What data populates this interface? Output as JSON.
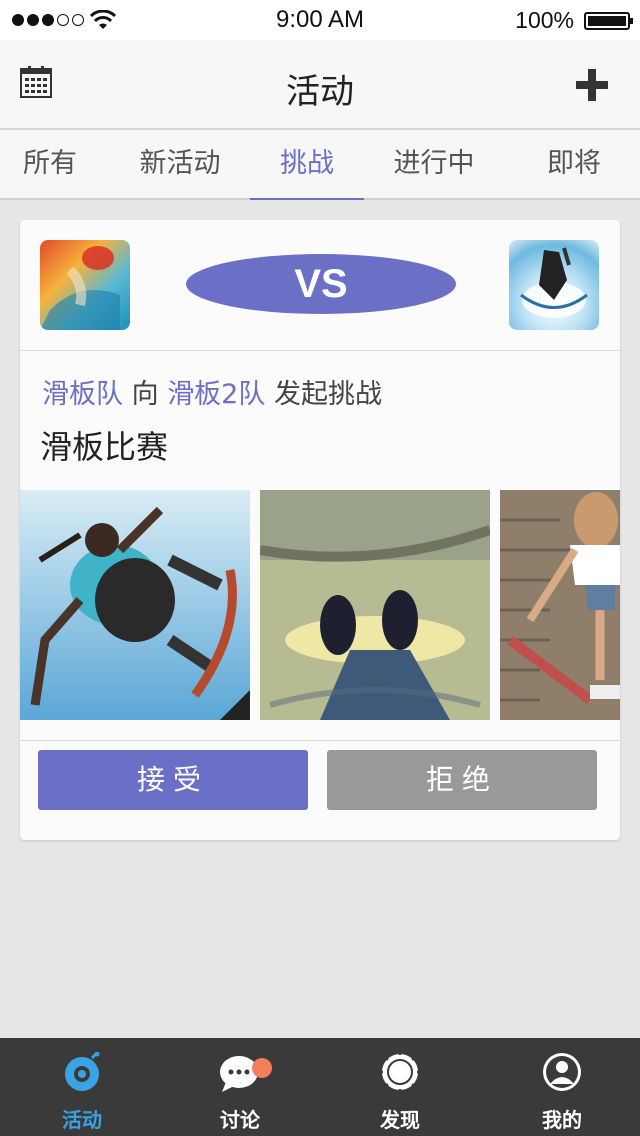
{
  "status_bar": {
    "time": "9:00 AM",
    "battery": "100%"
  },
  "header": {
    "title": "活动"
  },
  "tabs": [
    {
      "label": "所有"
    },
    {
      "label": "新活动"
    },
    {
      "label": "挑战",
      "active": true
    },
    {
      "label": "进行中"
    },
    {
      "label": "即将"
    }
  ],
  "card": {
    "vs": "VS",
    "challenger": "滑板队",
    "connector": "向",
    "opponent": "滑板2队",
    "action": "发起挑战",
    "title": "滑板比赛",
    "accept_label": "接受",
    "reject_label": "拒绝"
  },
  "bottom_nav": [
    {
      "label": "活动",
      "icon": "activity-icon",
      "active": true
    },
    {
      "label": "讨论",
      "icon": "chat-icon",
      "badge": true
    },
    {
      "label": "发现",
      "icon": "discover-icon"
    },
    {
      "label": "我的",
      "icon": "profile-icon"
    }
  ],
  "colors": {
    "accent": "#6b70c6",
    "nav_active": "#3aa3e3",
    "badge": "#f07f5a",
    "reject": "#999999"
  }
}
